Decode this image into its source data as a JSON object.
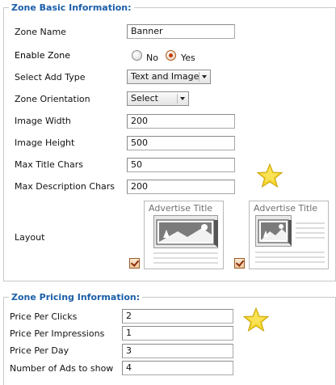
{
  "basic": {
    "legend": "Zone Basic Information:",
    "zone_name": {
      "label": "Zone Name",
      "value": "Banner"
    },
    "enable_zone": {
      "label": "Enable Zone",
      "options": [
        "No",
        "Yes"
      ],
      "selected": "Yes"
    },
    "ad_type": {
      "label": "Select Add Type",
      "value": "Text and Image"
    },
    "orientation": {
      "label": "Zone Orientation",
      "value": "Select"
    },
    "image_width": {
      "label": "Image Width",
      "value": "200"
    },
    "image_height": {
      "label": "Image Height",
      "value": "500"
    },
    "max_title": {
      "label": "Max Title Chars",
      "value": "50"
    },
    "max_desc": {
      "label": "Max Description Chars",
      "value": "200"
    },
    "layout": {
      "label": "Layout",
      "options": [
        {
          "title": "Advertise Title",
          "checked": true
        },
        {
          "title": "Advertise Title",
          "checked": true
        }
      ]
    }
  },
  "pricing": {
    "legend": "Zone Pricing Information:",
    "price_clicks": {
      "label": "Price Per Clicks",
      "value": "2"
    },
    "price_impressions": {
      "label": "Price Per Impressions",
      "value": "1"
    },
    "price_day": {
      "label": "Price Per Day",
      "value": "3"
    },
    "num_ads": {
      "label": "Number of Ads to show",
      "value": "4"
    }
  },
  "colors": {
    "legend": "#1b5ea8",
    "star": "#f4d228",
    "checkbox": "#f0c79f"
  }
}
